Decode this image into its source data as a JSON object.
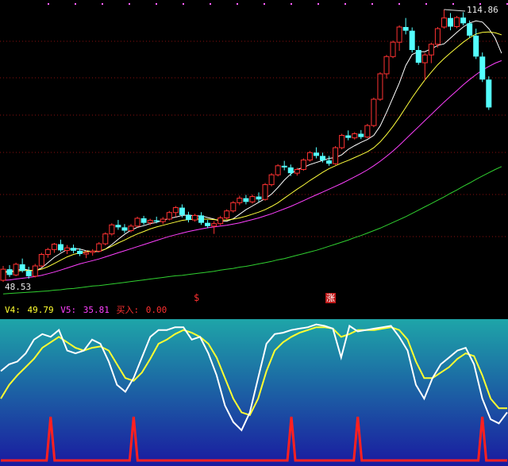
{
  "price_axis": {
    "high_label": "114.86",
    "low_label": "48.53"
  },
  "signals": {
    "s_label": "$",
    "zhang_label": "涨"
  },
  "indicator_legend": {
    "v4_label": "V4:",
    "v4_value": "49.79",
    "v5_label": "V5:",
    "v5_value": "35.81",
    "buy_label": "买入:",
    "buy_value": "0.00"
  },
  "colors": {
    "up": "#ff3232",
    "down": "#54ffff",
    "ma_white": "#ffffff",
    "ma_yellow": "#ffff3c",
    "ma_magenta": "#ff40ff",
    "ma_green": "#30d030",
    "v4": "#ffffff",
    "v5": "#ffff30",
    "buy": "#ff2020",
    "panel_top": "#1ea5a8",
    "panel_bottom": "#1a1aa0",
    "grid": "#8a1010",
    "dots": "#ff60ff"
  },
  "chart_data": [
    {
      "type": "candlestick",
      "title": "",
      "ylim": [
        48.53,
        114.86
      ],
      "grid": true,
      "candles": [
        {
          "o": 48.9,
          "h": 52.4,
          "l": 48.5,
          "c": 51.6
        },
        {
          "o": 51.6,
          "h": 52.6,
          "l": 49.7,
          "c": 50.2
        },
        {
          "o": 50.2,
          "h": 53.2,
          "l": 49.9,
          "c": 52.8
        },
        {
          "o": 52.8,
          "h": 54.2,
          "l": 50.8,
          "c": 51.2
        },
        {
          "o": 51.2,
          "h": 52.2,
          "l": 49.3,
          "c": 49.9
        },
        {
          "o": 49.9,
          "h": 52.9,
          "l": 49.6,
          "c": 52.4
        },
        {
          "o": 52.4,
          "h": 55.6,
          "l": 52.1,
          "c": 55.2
        },
        {
          "o": 55.2,
          "h": 56.8,
          "l": 54.4,
          "c": 56.4
        },
        {
          "o": 56.4,
          "h": 58.0,
          "l": 55.6,
          "c": 57.7
        },
        {
          "o": 57.7,
          "h": 58.8,
          "l": 55.8,
          "c": 56.2
        },
        {
          "o": 56.2,
          "h": 57.5,
          "l": 55.3,
          "c": 56.8
        },
        {
          "o": 56.8,
          "h": 57.6,
          "l": 55.5,
          "c": 56.1
        },
        {
          "o": 56.1,
          "h": 56.7,
          "l": 54.8,
          "c": 55.3
        },
        {
          "o": 55.3,
          "h": 56.2,
          "l": 54.3,
          "c": 55.7
        },
        {
          "o": 55.7,
          "h": 56.5,
          "l": 54.9,
          "c": 56.0
        },
        {
          "o": 56.0,
          "h": 58.2,
          "l": 55.7,
          "c": 57.8
        },
        {
          "o": 57.8,
          "h": 60.6,
          "l": 57.4,
          "c": 60.2
        },
        {
          "o": 60.2,
          "h": 62.8,
          "l": 59.8,
          "c": 62.4
        },
        {
          "o": 62.4,
          "h": 63.6,
          "l": 61.2,
          "c": 61.8
        },
        {
          "o": 61.8,
          "h": 62.6,
          "l": 60.4,
          "c": 61.0
        },
        {
          "o": 61.0,
          "h": 62.6,
          "l": 60.6,
          "c": 62.1
        },
        {
          "o": 62.1,
          "h": 64.4,
          "l": 61.8,
          "c": 64.0
        },
        {
          "o": 64.0,
          "h": 64.6,
          "l": 62.4,
          "c": 62.9
        },
        {
          "o": 62.9,
          "h": 63.9,
          "l": 62.3,
          "c": 63.5
        },
        {
          "o": 63.5,
          "h": 64.4,
          "l": 62.8,
          "c": 63.2
        },
        {
          "o": 63.2,
          "h": 64.3,
          "l": 62.6,
          "c": 63.8
        },
        {
          "o": 63.8,
          "h": 65.8,
          "l": 63.5,
          "c": 65.4
        },
        {
          "o": 65.4,
          "h": 67.0,
          "l": 64.3,
          "c": 66.6
        },
        {
          "o": 66.6,
          "h": 67.4,
          "l": 64.2,
          "c": 64.8
        },
        {
          "o": 64.8,
          "h": 65.6,
          "l": 63.0,
          "c": 63.6
        },
        {
          "o": 63.6,
          "h": 65.1,
          "l": 63.2,
          "c": 64.7
        },
        {
          "o": 64.7,
          "h": 65.5,
          "l": 62.4,
          "c": 62.9
        },
        {
          "o": 62.9,
          "h": 63.6,
          "l": 61.6,
          "c": 62.1
        },
        {
          "o": 62.1,
          "h": 63.3,
          "l": 60.2,
          "c": 62.7
        },
        {
          "o": 62.7,
          "h": 64.6,
          "l": 62.3,
          "c": 64.1
        },
        {
          "o": 64.1,
          "h": 66.2,
          "l": 63.7,
          "c": 65.8
        },
        {
          "o": 65.8,
          "h": 68.2,
          "l": 65.4,
          "c": 67.8
        },
        {
          "o": 67.8,
          "h": 69.5,
          "l": 67.2,
          "c": 68.9
        },
        {
          "o": 68.9,
          "h": 69.7,
          "l": 67.4,
          "c": 68.0
        },
        {
          "o": 68.0,
          "h": 69.8,
          "l": 67.6,
          "c": 69.3
        },
        {
          "o": 69.3,
          "h": 70.3,
          "l": 67.9,
          "c": 68.6
        },
        {
          "o": 68.6,
          "h": 72.6,
          "l": 68.3,
          "c": 72.2
        },
        {
          "o": 72.2,
          "h": 75.0,
          "l": 71.8,
          "c": 74.6
        },
        {
          "o": 74.6,
          "h": 77.2,
          "l": 74.2,
          "c": 76.8
        },
        {
          "o": 76.8,
          "h": 78.0,
          "l": 75.7,
          "c": 76.4
        },
        {
          "o": 76.4,
          "h": 77.1,
          "l": 74.3,
          "c": 75.0
        },
        {
          "o": 75.0,
          "h": 76.3,
          "l": 74.4,
          "c": 75.9
        },
        {
          "o": 75.9,
          "h": 78.6,
          "l": 75.6,
          "c": 78.2
        },
        {
          "o": 78.2,
          "h": 80.4,
          "l": 77.8,
          "c": 80.0
        },
        {
          "o": 80.0,
          "h": 81.3,
          "l": 78.6,
          "c": 79.2
        },
        {
          "o": 79.2,
          "h": 80.0,
          "l": 77.6,
          "c": 78.1
        },
        {
          "o": 78.1,
          "h": 79.2,
          "l": 76.8,
          "c": 77.3
        },
        {
          "o": 77.3,
          "h": 81.6,
          "l": 77.0,
          "c": 81.2
        },
        {
          "o": 81.2,
          "h": 84.6,
          "l": 80.8,
          "c": 84.2
        },
        {
          "o": 84.2,
          "h": 85.4,
          "l": 83.0,
          "c": 83.6
        },
        {
          "o": 83.6,
          "h": 85.0,
          "l": 83.2,
          "c": 84.6
        },
        {
          "o": 84.6,
          "h": 85.5,
          "l": 83.3,
          "c": 83.8
        },
        {
          "o": 83.8,
          "h": 87.0,
          "l": 83.5,
          "c": 86.6
        },
        {
          "o": 86.6,
          "h": 93.4,
          "l": 86.2,
          "c": 93.0
        },
        {
          "o": 93.0,
          "h": 99.6,
          "l": 92.6,
          "c": 99.2
        },
        {
          "o": 99.2,
          "h": 103.8,
          "l": 98.0,
          "c": 103.4
        },
        {
          "o": 103.4,
          "h": 107.3,
          "l": 103.0,
          "c": 106.9
        },
        {
          "o": 106.9,
          "h": 111.0,
          "l": 104.8,
          "c": 110.6
        },
        {
          "o": 110.6,
          "h": 112.8,
          "l": 108.8,
          "c": 109.7
        },
        {
          "o": 109.7,
          "h": 110.5,
          "l": 104.4,
          "c": 105.0
        },
        {
          "o": 105.0,
          "h": 106.0,
          "l": 101.4,
          "c": 101.9
        },
        {
          "o": 101.9,
          "h": 104.3,
          "l": 97.6,
          "c": 103.8
        },
        {
          "o": 103.8,
          "h": 106.8,
          "l": 101.8,
          "c": 106.4
        },
        {
          "o": 106.4,
          "h": 110.6,
          "l": 105.6,
          "c": 110.2
        },
        {
          "o": 110.6,
          "h": 114.86,
          "l": 110.2,
          "c": 112.8
        },
        {
          "o": 112.8,
          "h": 114.0,
          "l": 109.8,
          "c": 110.7
        },
        {
          "o": 110.7,
          "h": 113.3,
          "l": 110.3,
          "c": 112.9
        },
        {
          "o": 112.9,
          "h": 114.2,
          "l": 111.0,
          "c": 111.5
        },
        {
          "o": 111.5,
          "h": 112.2,
          "l": 108.0,
          "c": 108.5
        },
        {
          "o": 108.5,
          "h": 110.2,
          "l": 102.8,
          "c": 103.4
        },
        {
          "o": 103.4,
          "h": 104.4,
          "l": 97.2,
          "c": 97.8
        },
        {
          "o": 97.8,
          "h": 98.6,
          "l": 90.4,
          "c": 91.0
        }
      ],
      "moving_averages": [
        {
          "color": "#ffffff",
          "values": [
            51.0,
            51.1,
            51.3,
            51.7,
            51.4,
            51.2,
            51.9,
            53.2,
            54.5,
            55.5,
            56.4,
            56.6,
            56.5,
            56.1,
            55.9,
            55.9,
            56.5,
            57.6,
            58.9,
            60.1,
            61.1,
            61.8,
            62.2,
            62.7,
            63.0,
            63.5,
            64.0,
            64.3,
            64.7,
            64.8,
            64.6,
            64.6,
            64.2,
            63.8,
            63.3,
            63.3,
            63.9,
            65.0,
            66.1,
            67.0,
            67.9,
            68.8,
            69.9,
            71.5,
            73.3,
            74.8,
            75.9,
            76.4,
            77.1,
            77.6,
            78.1,
            78.6,
            78.8,
            79.5,
            80.8,
            81.7,
            82.5,
            83.2,
            84.2,
            86.5,
            89.8,
            93.4,
            97.0,
            101.2,
            103.9,
            104.6,
            104.6,
            105.3,
            106.1,
            106.5,
            107.9,
            109.3,
            110.6,
            111.6,
            112.1,
            111.8,
            110.2,
            107.9,
            104.2
          ]
        },
        {
          "color": "#ffff3c",
          "values": [
            50.8,
            50.9,
            51.1,
            51.3,
            51.3,
            51.3,
            51.6,
            52.2,
            53.0,
            53.8,
            54.6,
            55.2,
            55.6,
            55.9,
            56.0,
            56.0,
            56.5,
            57.2,
            58.0,
            58.7,
            59.5,
            60.2,
            60.8,
            61.4,
            61.9,
            62.3,
            62.7,
            63.1,
            63.5,
            63.7,
            63.8,
            63.8,
            63.8,
            63.7,
            63.6,
            63.6,
            63.8,
            64.1,
            64.5,
            65.0,
            65.5,
            66.1,
            66.9,
            67.8,
            68.9,
            70.0,
            71.1,
            72.1,
            73.2,
            74.2,
            75.2,
            76.1,
            76.8,
            77.5,
            78.1,
            78.8,
            79.5,
            80.2,
            81.2,
            82.6,
            84.4,
            86.4,
            88.6,
            91.0,
            93.4,
            95.6,
            97.7,
            99.6,
            101.4,
            102.9,
            104.3,
            105.6,
            106.9,
            108.0,
            108.9,
            109.3,
            109.4,
            109.2,
            108.7
          ]
        },
        {
          "color": "#ff40ff",
          "values": [
            48.9,
            49.0,
            49.2,
            49.4,
            49.6,
            49.8,
            50.1,
            50.5,
            50.9,
            51.4,
            51.9,
            52.4,
            52.9,
            53.3,
            53.7,
            54.1,
            54.6,
            55.1,
            55.6,
            56.1,
            56.6,
            57.1,
            57.6,
            58.1,
            58.6,
            59.1,
            59.6,
            60.0,
            60.4,
            60.8,
            61.1,
            61.4,
            61.7,
            61.9,
            62.1,
            62.3,
            62.6,
            62.9,
            63.3,
            63.7,
            64.1,
            64.6,
            65.1,
            65.7,
            66.3,
            66.9,
            67.6,
            68.3,
            69.0,
            69.7,
            70.4,
            71.1,
            71.8,
            72.5,
            73.3,
            74.1,
            74.9,
            75.8,
            76.8,
            77.9,
            79.1,
            80.4,
            81.8,
            83.3,
            84.8,
            86.3,
            87.8,
            89.3,
            90.8,
            92.3,
            93.7,
            95.1,
            96.5,
            97.8,
            99.0,
            100.1,
            101.0,
            101.8,
            102.4
          ]
        },
        {
          "color": "#30d030",
          "values": [
            45.6,
            45.7,
            45.8,
            45.9,
            46.0,
            46.1,
            46.2,
            46.3,
            46.5,
            46.6,
            46.8,
            46.9,
            47.1,
            47.3,
            47.5,
            47.6,
            47.8,
            48.0,
            48.2,
            48.4,
            48.6,
            48.8,
            49.0,
            49.2,
            49.4,
            49.6,
            49.8,
            50.0,
            50.1,
            50.3,
            50.5,
            50.7,
            50.9,
            51.1,
            51.4,
            51.6,
            51.8,
            52.1,
            52.3,
            52.6,
            52.9,
            53.2,
            53.5,
            53.9,
            54.2,
            54.6,
            55.0,
            55.4,
            55.8,
            56.2,
            56.7,
            57.2,
            57.7,
            58.2,
            58.7,
            59.3,
            59.8,
            60.4,
            61.0,
            61.6,
            62.3,
            63.0,
            63.7,
            64.4,
            65.2,
            66.0,
            66.8,
            67.6,
            68.4,
            69.2,
            70.1,
            70.9,
            71.8,
            72.6,
            73.5,
            74.3,
            75.1,
            75.9,
            76.6
          ]
        }
      ]
    },
    {
      "type": "line",
      "title": "",
      "ylim": [
        0,
        100
      ],
      "series": [
        {
          "name": "V4",
          "color": "#ffffff",
          "values": [
            65,
            70,
            72,
            78,
            88,
            92,
            90,
            95,
            80,
            78,
            80,
            88,
            85,
            72,
            55,
            50,
            60,
            75,
            90,
            95,
            95,
            97,
            97,
            88,
            90,
            78,
            62,
            40,
            28,
            22,
            35,
            60,
            85,
            92,
            93,
            95,
            96,
            97,
            99,
            98,
            96,
            75,
            98,
            94,
            95,
            96,
            97,
            98,
            90,
            80,
            55,
            45,
            60,
            70,
            75,
            80,
            82,
            70,
            45,
            30,
            27,
            35
          ]
        },
        {
          "name": "V5",
          "color": "#ffff30",
          "values": [
            45,
            55,
            62,
            68,
            74,
            82,
            86,
            90,
            86,
            82,
            80,
            82,
            83,
            80,
            70,
            60,
            58,
            64,
            74,
            85,
            88,
            92,
            95,
            93,
            90,
            85,
            75,
            60,
            45,
            35,
            33,
            45,
            65,
            80,
            86,
            90,
            93,
            95,
            97,
            97,
            96,
            90,
            92,
            95,
            95,
            95,
            96,
            97,
            95,
            88,
            72,
            60,
            60,
            64,
            68,
            74,
            78,
            76,
            62,
            45,
            38,
            38
          ]
        },
        {
          "name": "买入",
          "color": "#ff2020",
          "type": "spike",
          "values": [
            0,
            0,
            0,
            0,
            0,
            0,
            0,
            0,
            0,
            0,
            0,
            0,
            0,
            0,
            0,
            0,
            0,
            0,
            0,
            0,
            0,
            0,
            0,
            0,
            0,
            0,
            0,
            0,
            0,
            0,
            0,
            0,
            0,
            0,
            0,
            0,
            0,
            0,
            0,
            0,
            0,
            0,
            0,
            0,
            0,
            0,
            0,
            0,
            0,
            0,
            0,
            0,
            0,
            0,
            0,
            0,
            0,
            0,
            0,
            0,
            0,
            0
          ],
          "spike_indices": [
            6,
            16,
            35,
            43,
            58
          ]
        }
      ]
    }
  ]
}
